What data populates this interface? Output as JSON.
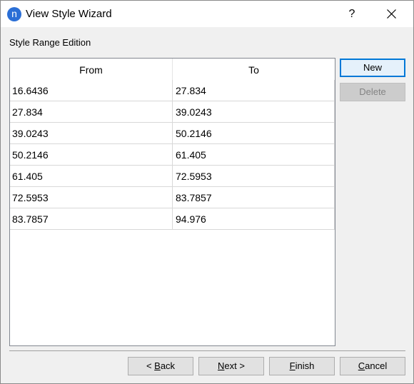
{
  "window": {
    "title": "View Style Wizard",
    "app_icon_letter": "n",
    "help_label": "?"
  },
  "section": {
    "label": "Style Range Edition"
  },
  "table": {
    "columns": [
      "From",
      "To"
    ],
    "rows": [
      [
        "16.6436",
        "27.834"
      ],
      [
        "27.834",
        "39.0243"
      ],
      [
        "39.0243",
        "50.2146"
      ],
      [
        "50.2146",
        "61.405"
      ],
      [
        "61.405",
        "72.5953"
      ],
      [
        "72.5953",
        "83.7857"
      ],
      [
        "83.7857",
        "94.976"
      ]
    ]
  },
  "side_buttons": {
    "new_label": "New",
    "delete_label": "Delete"
  },
  "footer": {
    "back": {
      "prefix": "< ",
      "mnemonic": "B",
      "rest": "ack"
    },
    "next": {
      "mnemonic": "N",
      "rest": "ext >"
    },
    "finish": {
      "mnemonic": "F",
      "rest": "inish"
    },
    "cancel": {
      "mnemonic": "C",
      "rest": "ancel"
    }
  }
}
